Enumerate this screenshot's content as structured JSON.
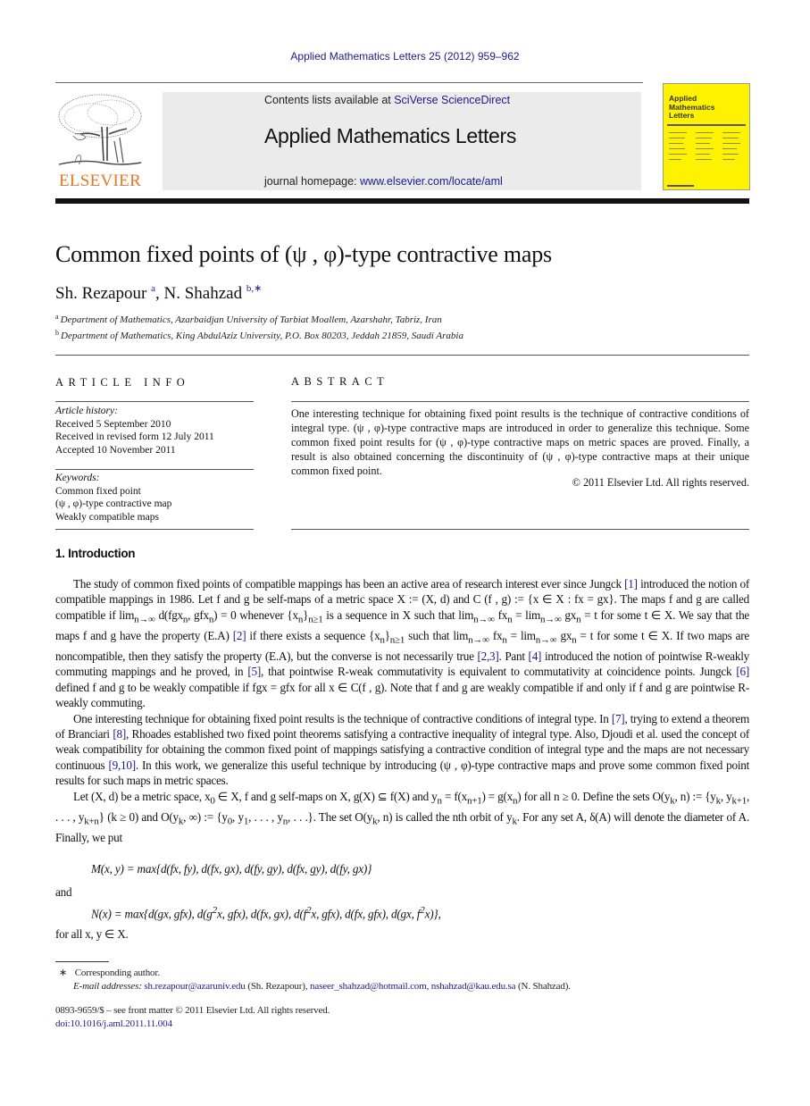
{
  "header": {
    "citation": "Applied Mathematics Letters 25 (2012) 959–962",
    "contents_prefix": "Contents lists available at ",
    "contents_link": "SciVerse ScienceDirect",
    "journal_title": "Applied Mathematics Letters",
    "homepage_prefix": "journal homepage: ",
    "homepage_link": "www.elsevier.com/locate/aml",
    "publisher_logo_text": "ELSEVIER",
    "cover_title_lines": [
      "Applied",
      "Mathematics",
      "Letters"
    ],
    "colors": {
      "link": "#1a1a8c",
      "publisher_orange": "#e87722",
      "cover_yellow": "#fff200",
      "banner_gray": "#ebebeb"
    }
  },
  "article": {
    "title": "Common fixed points of (ψ , φ)-type contractive maps",
    "authors": [
      {
        "name": "Sh. Rezapour",
        "marks": "a"
      },
      {
        "name": "N. Shahzad",
        "marks": "b,∗"
      }
    ],
    "affiliations": [
      {
        "mark": "a",
        "text": "Department of Mathematics, Azarbaidjan University of Tarbiat Moallem, Azarshahr, Tabriz, Iran"
      },
      {
        "mark": "b",
        "text": "Department of Mathematics, King AbdulAziz University, P.O. Box 80203, Jeddah 21859, Saudi Arabia"
      }
    ]
  },
  "article_info": {
    "heading": "ARTICLE INFO",
    "history_label": "Article history:",
    "history": [
      "Received 5 September 2010",
      "Received in revised form 12 July 2011",
      "Accepted 10 November 2011"
    ],
    "keywords_label": "Keywords:",
    "keywords": [
      "Common fixed point",
      "(ψ , φ)-type contractive map",
      "Weakly compatible maps"
    ]
  },
  "abstract": {
    "heading": "ABSTRACT",
    "text": "One interesting technique for obtaining fixed point results is the technique of contractive conditions of integral type. (ψ , φ)-type contractive maps are introduced in order to generalize this technique. Some common fixed point results for (ψ , φ)-type contractive maps on metric spaces are proved. Finally, a result is also obtained concerning the discontinuity of (ψ , φ)-type contractive maps at their unique common fixed point.",
    "copyright": "© 2011 Elsevier Ltd. All rights reserved."
  },
  "introduction": {
    "heading": "1.  Introduction",
    "p1": {
      "a": "The study of common fixed points of compatible mappings has been an active area of research interest ever since Jungck ",
      "r1": "[1]",
      "b": " introduced the notion of compatible mappings in 1986. Let f and g be self-maps of a metric space X := (X, d) and C (f , g) := {x ∈ X : fx = gx}. The maps f and g are called compatible if lim",
      "sub1": "n→∞",
      "c": " d(fgx",
      "sub_n1": "n",
      "d": ", gfx",
      "sub_n2": "n",
      "e": ") = 0 whenever {x",
      "sub_n3": "n",
      "f": "}",
      "sub_ge1": "n≥1",
      "g": " is a sequence in X such that lim",
      "sub2": "n→∞",
      "h": " fx",
      "sub_n4": "n",
      "i": " = lim",
      "sub3": "n→∞",
      "j": " gx",
      "sub_n5": "n",
      "k": " = t for some t ∈ X. We say that the maps f and g have the property (E.A) ",
      "r2": "[2]",
      "l": " if there exists a sequence {x",
      "sub_n6": "n",
      "m": "}",
      "sub_ge2": "n≥1",
      "n": " such that lim",
      "sub4": "n→∞",
      "o": " fx",
      "sub_n7": "n",
      "p": " = lim",
      "sub5": "n→∞",
      "q": " gx",
      "sub_n8": "n",
      "r": " = t for some t ∈ X. If two maps are noncompatible, then they satisfy the property (E.A), but the converse is not necessarily true ",
      "r3": "[2,3]",
      "s": ". Pant ",
      "r4": "[4]",
      "t": " introduced the notion of pointwise R-weakly commuting mappings and he proved, in ",
      "r5": "[5]",
      "u": ", that pointwise R-weak commutativity is equivalent to commutativity at coincidence points. Jungck ",
      "r6": "[6]",
      "v": " defined f and g to be weakly compatible if fgx = gfx for all x ∈ C(f , g). Note that f and g are weakly compatible if and only if f and g are pointwise R-weakly commuting."
    },
    "p2": {
      "a": "One interesting technique for obtaining fixed point results is the technique of contractive conditions of integral type. In ",
      "r7": "[7]",
      "b": ", trying to extend a theorem of Branciari ",
      "r8": "[8]",
      "c": ", Rhoades established two fixed point theorems satisfying a contractive inequality of integral type. Also, Djoudi et al. used the concept of weak compatibility for obtaining the common fixed point of mappings satisfying a contractive condition of integral type and the maps are not necessary continuous ",
      "r9": "[9,10]",
      "d": ". In this work, we generalize this useful technique by introducing (ψ , φ)-type contractive maps and prove some common fixed point results for such maps in metric spaces."
    },
    "p3": {
      "a": "Let (X, d) be a metric space, x",
      "sub0": "0",
      "b": " ∈ X, f and g self-maps on X, g(X) ⊆ f(X) and y",
      "subn": "n",
      "c": " = f(x",
      "subn1": "n+1",
      "d": ") = g(x",
      "subn2": "n",
      "e": ") for all n ≥ 0. Define the sets O(y",
      "subk1": "k",
      "f": ", n) := {y",
      "subk2": "k",
      "g": ", y",
      "subk3": "k+1",
      "h": ", . . . , y",
      "subk4": "k+n",
      "i": "} (k ≥ 0) and O(y",
      "subk5": "k",
      "j": ", ∞) := {y",
      "sub00": "0",
      "k": ", y",
      "sub01": "1",
      "l": ", . . . , y",
      "subnn": "n",
      "m": ", . . .}. The set O(y",
      "subk6": "k",
      "n": ", n) is called the nth orbit of y",
      "subk7": "k",
      "o": ". For any set A, δ(A) will denote the diameter of A. Finally, we put"
    },
    "eq1": "M(x, y) = max{d(fx, fy), d(fx, gx), d(fy, gy), d(fx, gy), d(fy, gx)}",
    "and_word": "and",
    "eq2": {
      "a": "N(x) = max{d(gx, gfx), d(g",
      "sup1": "2",
      "b": "x, gfx), d(fx, gx), d(f",
      "sup2": "2",
      "c": "x, gfx), d(fx, gfx), d(gx, f",
      "sup3": "2",
      "d": "x)},"
    },
    "for_all": "for all x, y ∈ X."
  },
  "footnotes": {
    "star": "∗",
    "corresponding": "Corresponding author.",
    "email_label": "E-mail addresses:",
    "email1": "sh.rezapour@azaruniv.edu",
    "email1_owner": " (Sh. Rezapour), ",
    "email2": "naseer_shahzad@hotmail.com",
    "sep": ", ",
    "email3": "nshahzad@kau.edu.sa",
    "email3_owner": " (N. Shahzad).",
    "front_matter": "0893-9659/$ – see front matter © 2011 Elsevier Ltd. All rights reserved.",
    "doi": "doi:10.1016/j.aml.2011.11.004"
  }
}
